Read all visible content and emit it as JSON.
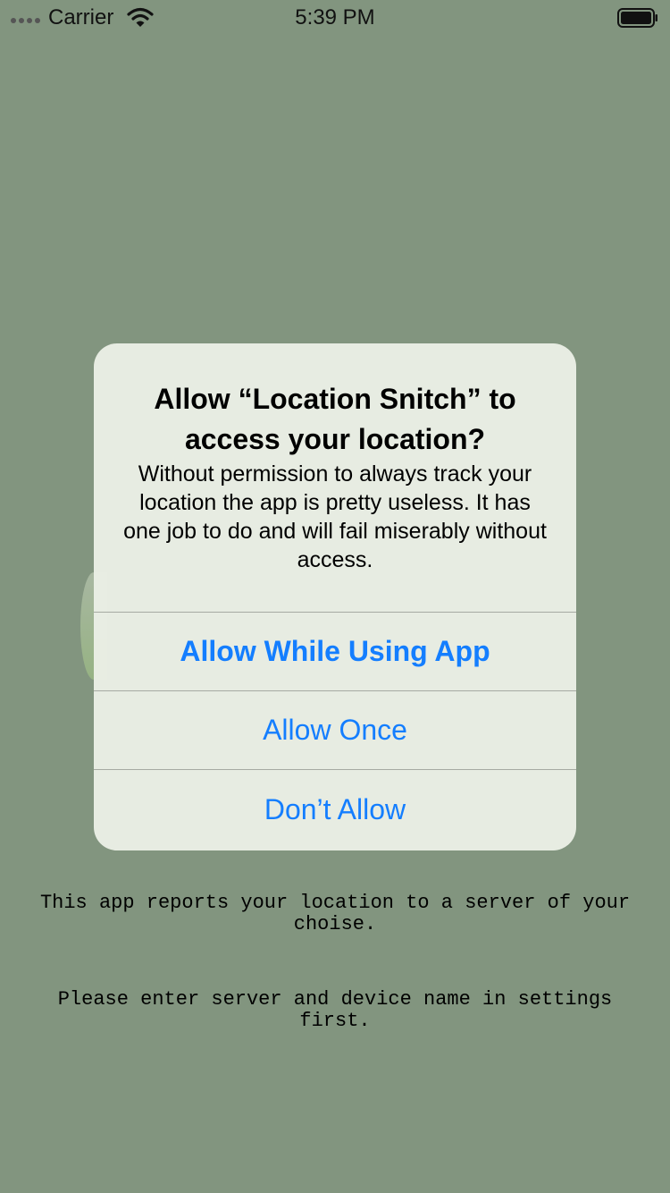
{
  "status_bar": {
    "carrier": "Carrier",
    "time": "5:39 PM",
    "icons": [
      "signal-dots-icon",
      "wifi-icon",
      "battery-icon"
    ]
  },
  "alert": {
    "title": "Allow “Location Snitch” to access your location?",
    "message": "Without permission to always track your location the app is pretty useless. It has one job to do and will fail miserably without access.",
    "buttons": [
      {
        "label": "Allow While Using App",
        "style": "bold"
      },
      {
        "label": "Allow Once",
        "style": "regular"
      },
      {
        "label": "Don’t Allow",
        "style": "regular"
      }
    ],
    "accent_color": "#147eff"
  },
  "main": {
    "info_text": "This app reports your location to a server of your choise.",
    "setup_text": "Please enter server and device name in settings first."
  },
  "colors": {
    "background": "#82957f",
    "alert_background": "#eaeee5"
  }
}
